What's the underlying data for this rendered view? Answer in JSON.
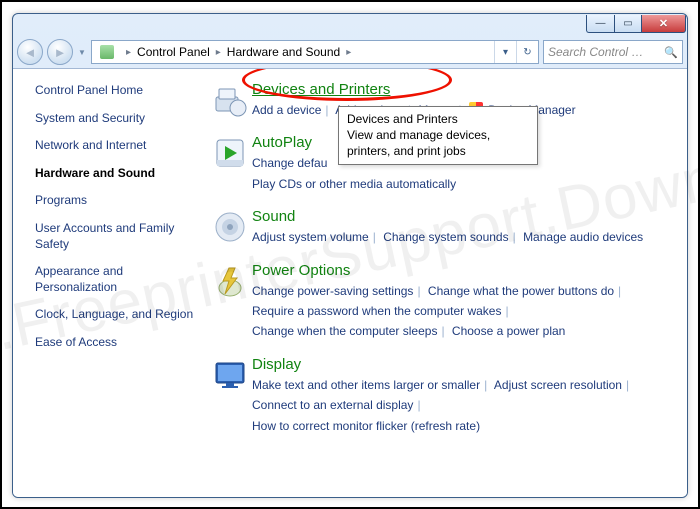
{
  "breadcrumb": [
    "Control Panel",
    "Hardware and Sound"
  ],
  "search": {
    "placeholder": "Search Control …"
  },
  "sidebar": [
    {
      "label": "Control Panel Home"
    },
    {
      "label": "System and Security"
    },
    {
      "label": "Network and Internet"
    },
    {
      "label": "Hardware and Sound",
      "active": true
    },
    {
      "label": "Programs"
    },
    {
      "label": "User Accounts and Family Safety"
    },
    {
      "label": "Appearance and Personalization"
    },
    {
      "label": "Clock, Language, and Region"
    },
    {
      "label": "Ease of Access"
    }
  ],
  "sections": [
    {
      "title": "Devices and Printers",
      "links": [
        "Add a device",
        "Add a printer",
        "Mouse",
        "Device Manager"
      ]
    },
    {
      "title": "AutoPlay",
      "links": [
        "Change defau",
        "Play CDs or other media automatically"
      ]
    },
    {
      "title": "Sound",
      "links": [
        "Adjust system volume",
        "Change system sounds",
        "Manage audio devices"
      ]
    },
    {
      "title": "Power Options",
      "links": [
        "Change power-saving settings",
        "Change what the power buttons do",
        "Require a password when the computer wakes",
        "Change when the computer sleeps",
        "Choose a power plan"
      ]
    },
    {
      "title": "Display",
      "links": [
        "Make text and other items larger or smaller",
        "Adjust screen resolution",
        "Connect to an external display",
        "How to correct monitor flicker (refresh rate)"
      ]
    }
  ],
  "tooltip": {
    "title": "Devices and Printers",
    "body": "View and manage devices, printers, and print jobs"
  },
  "watermark": "www.FreeprinterSupport.Download"
}
